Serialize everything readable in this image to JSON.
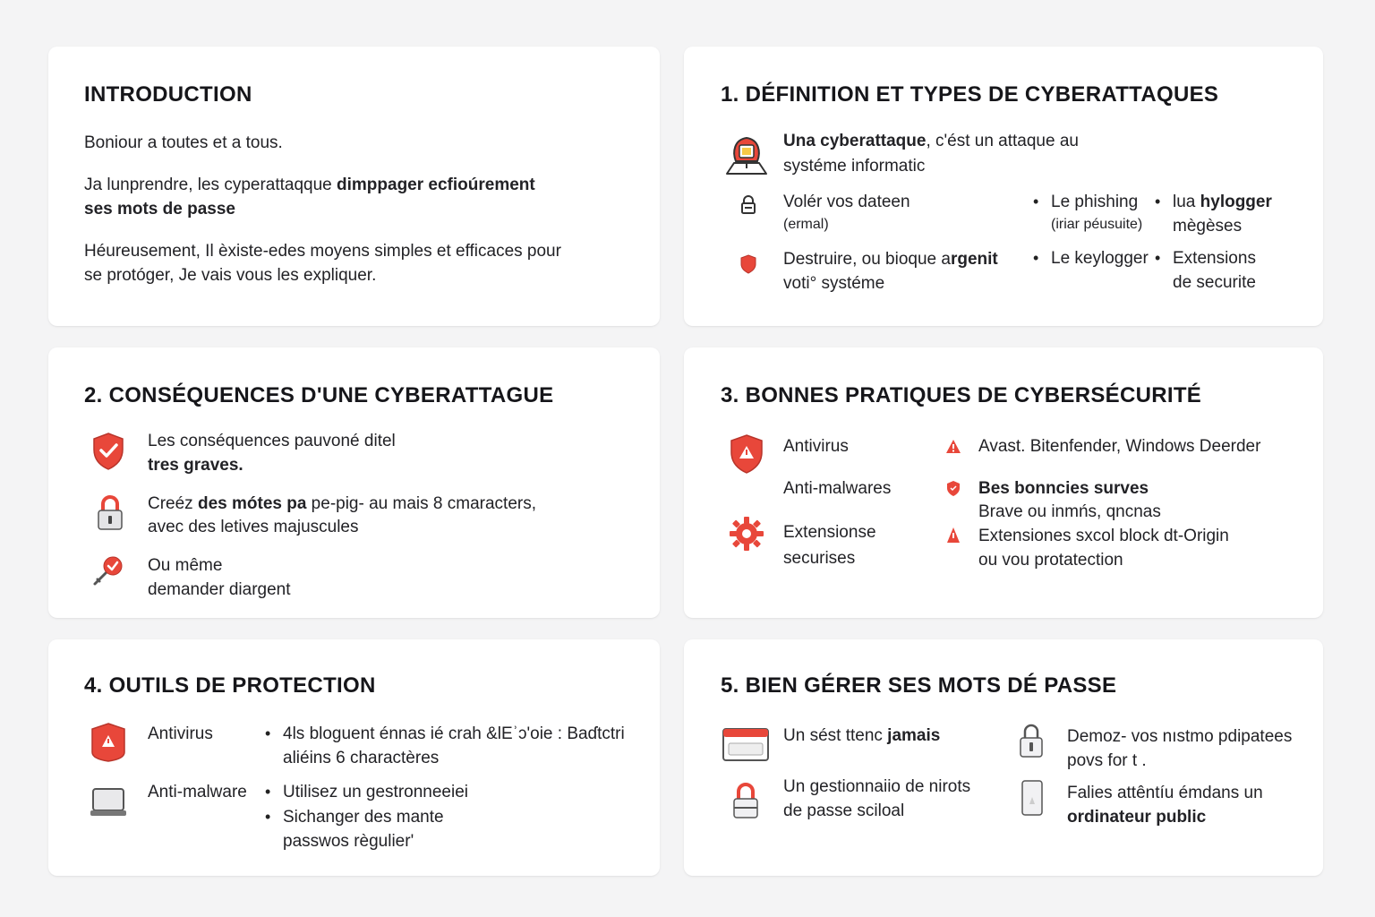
{
  "intro": {
    "title": "INTRODUCTION",
    "p1": "Boniour a toutes et a tous.",
    "p2_a": "Ja lunprendre, les cyperattaqque ",
    "p2_b": "dimppager ecfioúrement",
    "p2_c": "ses mots de passe",
    "p3_l1": "Héureusement, Il èxiste-edes moyens simples et efficaces pour",
    "p3_l2": "se protóger,  Je vais vous les expliquer."
  },
  "definition": {
    "title": "1. DÉFINITION ET TYPES DE CYBERATTAQUES",
    "intro_bold": "Una cyberattaque",
    "intro_rest": ", c'ést un attaque au",
    "intro_l2": "systéme informatic",
    "item1_l1": "Volér vos dateen",
    "item1_l2": "(ermal)",
    "item2_a": "Destruire, ou bioque a",
    "item2_b": "rgenit",
    "item2_l2": "voti° systéme",
    "types": [
      {
        "label": "Le phishing",
        "sub": "(iriar péusuite)"
      },
      {
        "label": "lua ",
        "bold": "hylogger",
        "sub": "mègèses"
      },
      {
        "label": "Le keylogger",
        "sub": ""
      },
      {
        "label": "Extensions",
        "sub": "de securite"
      }
    ],
    "icons": [
      "email-icon",
      "lock-icon",
      "shield-icon"
    ]
  },
  "consequences": {
    "title": "2. CONSÉQUENCES D'UNE CYBERATTAGUE",
    "i1_l1": "Les conséquences pauvoné ditel",
    "i1_l2": "tres graves.",
    "i2_a": "Creéz ",
    "i2_b": "des mótes pa",
    "i2_c": " pe-pig- au mais 8 cmaracters,",
    "i2_l2": "avec des letives majuscules",
    "i3_l1": "Ou même",
    "i3_l2": "demander diargent",
    "icons": [
      "shield-check-icon",
      "padlock-icon",
      "key-icon"
    ]
  },
  "bonnes_pratiques": {
    "title": "3. BONNES PRATIQUES DE CYBERSÉCURITÉ",
    "left": [
      "Antivirus",
      "Anti-malwares",
      "Extensionse",
      "securises"
    ],
    "right_1": "Avast. Bitenfender, Windows Deerder",
    "right_2": "Bes bonncies surves",
    "right_2b": "Brave ou inmńs, qncnas",
    "right_3": "Extensiones sxcol block dt-Origin",
    "right_3b": "ou vou protatection",
    "icons": [
      "warning-shield-icon",
      "gear-icon"
    ]
  },
  "outils": {
    "title": "4. OUTILS DE PROTECTION",
    "a1": "Antivirus",
    "a2": "Anti-malware",
    "b1_l1": "4ls bloguent énnas ié crah &lEʾɔ'oie : Baɗtctri",
    "b1_l2": "aliéins 6 charactères",
    "b2": "Utilisez un gestronneeiei",
    "b3_l1": "Sichanger des mante",
    "b3_l2": "passwos règulier'",
    "bullet": "•",
    "icons": [
      "antivirus-shield-icon",
      "laptop-icon"
    ]
  },
  "passwords": {
    "title": "5. BIEN GÉRER SES MOTS DÉ PASSE",
    "l1_a": "Un sést ttenc ",
    "l1_b": "jamais",
    "l2_l1": "Un gestionnaiio de nirots",
    "l2_l2": "de passe sciloal",
    "r1_l1": "Demoz- vos nıstmo pdipatees",
    "r1_l2": "povs for t .",
    "r2_l1": "Falies attêntíu émdans un",
    "r2_l2": "ordinateur public",
    "icons": [
      "browser-window-icon",
      "lock-icon",
      "padlock-icon",
      "phone-icon"
    ]
  },
  "colors": {
    "accent": "#e8473a",
    "text": "#1c1c1f",
    "background": "#f4f4f5"
  }
}
